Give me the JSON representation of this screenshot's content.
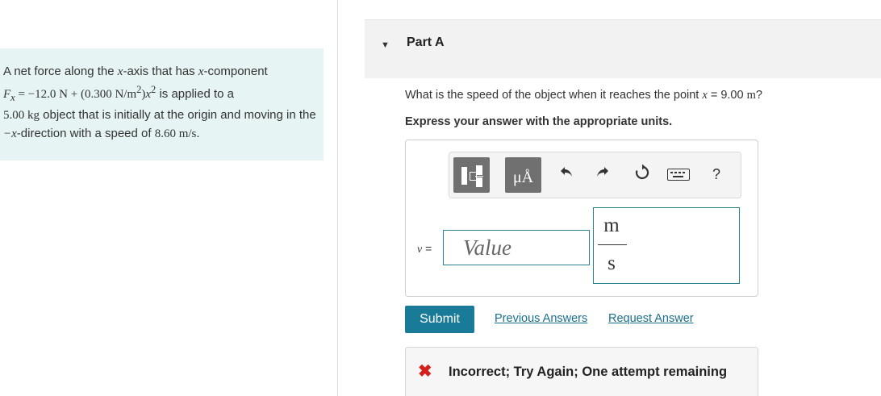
{
  "problem": {
    "text_1": "A net force along the ",
    "x": "x",
    "text_2": "-axis that has ",
    "text_3": "-component",
    "force_var": "F",
    "force_sub": "x",
    "force_eq": " = −12.0 N + (0.300 N/m",
    "force_exp1": "2",
    "force_eq2": ")",
    "force_exp2": "2",
    "text_4": " is applied to a",
    "mass": "5.00 kg",
    "text_5": " object that is initially at the origin and moving in the ",
    "minus_x": "−x",
    "text_6": "-direction with a speed of ",
    "speed": "8.60 m/s",
    "period": "."
  },
  "part": {
    "caret": "▼",
    "title": "Part A"
  },
  "question": {
    "text": "What is the speed of the object when it reaches the point ",
    "var": "x",
    "eq": " = 9.00 ",
    "unit": "m",
    "end": "?"
  },
  "instruction": "Express your answer with the appropriate units.",
  "toolbar": {
    "units_label": "μÅ",
    "undo_icon": "undo-icon",
    "redo_icon": "redo-icon",
    "reset_icon": "reset-icon",
    "keyboard_icon": "keyboard-icon",
    "help_label": "?"
  },
  "answer": {
    "var": "v",
    "equals": " =",
    "placeholder": "Value",
    "unit_numerator": "m",
    "unit_denominator": "s"
  },
  "actions": {
    "submit_label": "Submit",
    "previous_answers": "Previous Answers",
    "request_answer": "Request Answer"
  },
  "feedback": {
    "icon": "✖",
    "text": "Incorrect; Try Again; One attempt remaining"
  },
  "colors": {
    "accent": "#1a7b98",
    "error": "#d4201b",
    "problem_bg": "#e6f4f4"
  }
}
